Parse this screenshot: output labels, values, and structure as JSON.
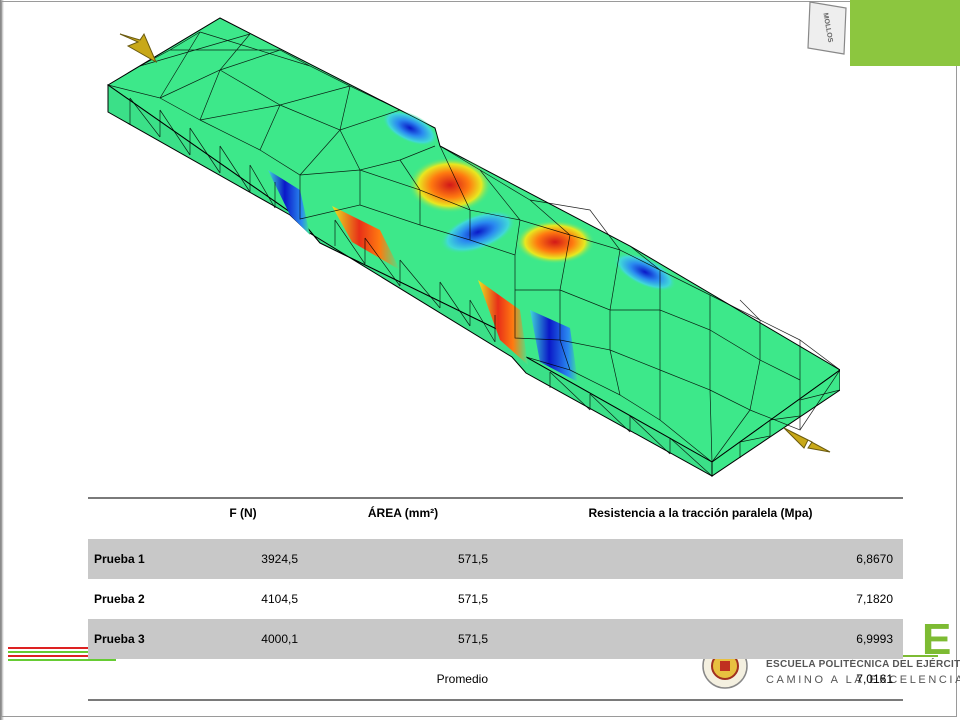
{
  "slide": {
    "tag_text": "MOLLOS"
  },
  "table": {
    "headers": [
      "",
      "F (N)",
      "ÁREA (mm²)",
      "Resistencia a la tracción paralela (Mpa)"
    ],
    "rows": [
      {
        "label": "Prueba 1",
        "force": "3924,5",
        "area": "571,5",
        "strength": "6,8670"
      },
      {
        "label": "Prueba 2",
        "force": "4104,5",
        "area": "571,5",
        "strength": "7,1820"
      },
      {
        "label": "Prueba 3",
        "force": "4000,1",
        "area": "571,5",
        "strength": "6,9993"
      }
    ],
    "average_label": "Promedio",
    "average_value": "7,0161"
  },
  "logo": {
    "letter": "E",
    "line1": "ESCUELA POLITÉCNICA DEL EJÉRCITO",
    "line2": "CAMINO A LA EXCELENCIA"
  },
  "colors": {
    "accent_green": "#8cc63f",
    "fem_base": "#3de88a",
    "stress_red": "#e8281c",
    "stress_blue": "#1228d8"
  }
}
